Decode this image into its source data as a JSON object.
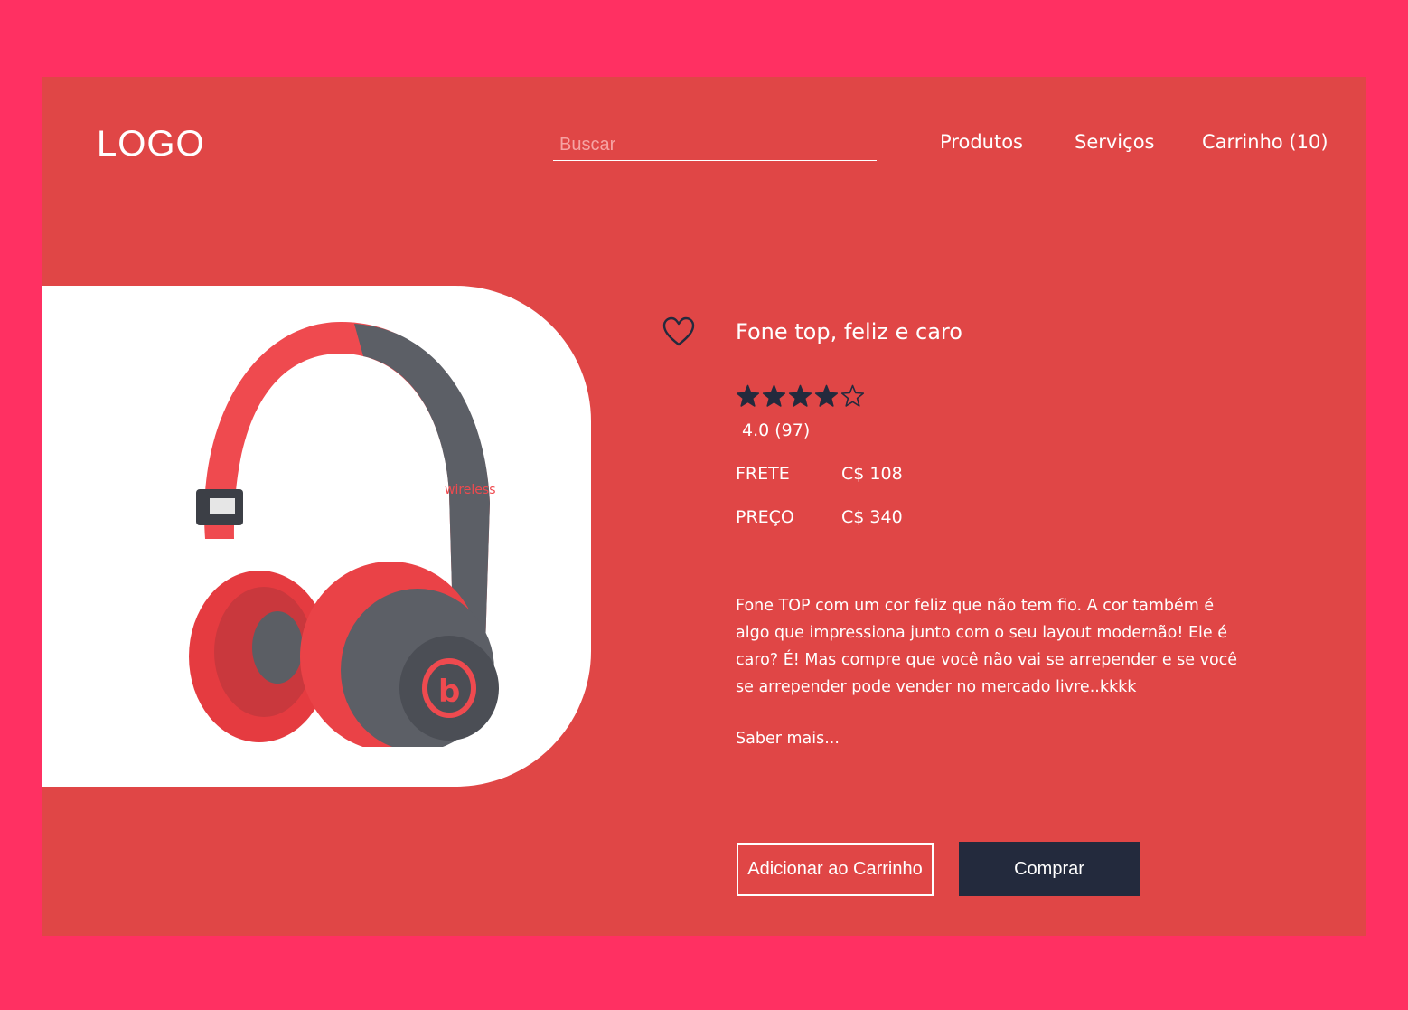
{
  "header": {
    "logo": "LOGO",
    "search_placeholder": "Buscar",
    "nav": {
      "produtos": "Produtos",
      "servicos": "Serviços",
      "carrinho": "Carrinho (10)"
    }
  },
  "product": {
    "title": "Fone top, feliz e caro",
    "rating_stars": 4,
    "rating_max": 5,
    "rating_text": "4.0 (97)",
    "frete_label": "FRETE",
    "frete_value": "C$ 108",
    "preco_label": "PREÇO",
    "preco_value": "C$ 340",
    "description": "Fone TOP com um cor feliz que não tem fio. A cor também é algo que impressiona junto com o seu layout modernão! Ele é caro? É! Mas compre que você não vai se arrepender e se você se arrepender pode vender no mercado livre..kkkk",
    "more_link": "Saber mais...",
    "image_brand_text": "wireless"
  },
  "actions": {
    "add_to_cart": "Adicionar ao Carrinho",
    "buy": "Comprar"
  },
  "colors": {
    "page_background": "#ff3062",
    "card_background": "#e04646",
    "dark": "#232a3d",
    "text": "#ffffff"
  },
  "icons": {
    "favorite": "heart-outline-icon",
    "star_filled": "star-filled-icon",
    "star_empty": "star-outline-icon"
  }
}
